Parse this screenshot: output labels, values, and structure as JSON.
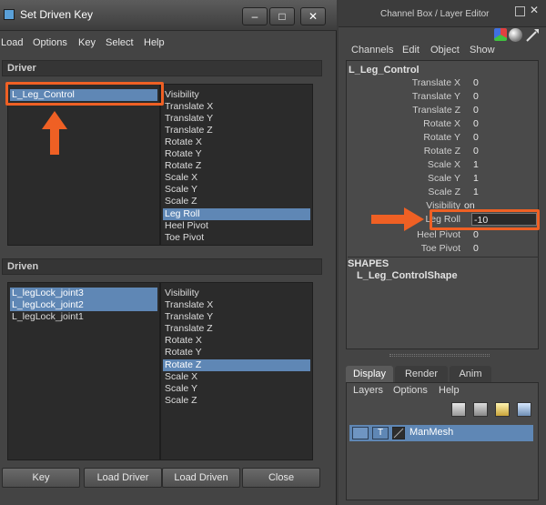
{
  "sdk": {
    "title": "Set Driven Key",
    "winbtns": [
      "–",
      "□",
      "✕"
    ],
    "menu": [
      "Load",
      "Options",
      "Key",
      "Select",
      "Help"
    ],
    "driver": {
      "header": "Driver",
      "objects": [
        "L_Leg_Control"
      ],
      "attributes": [
        "Visibility",
        "Translate X",
        "Translate Y",
        "Translate Z",
        "Rotate X",
        "Rotate Y",
        "Rotate Z",
        "Scale X",
        "Scale Y",
        "Scale Z",
        "Leg Roll",
        "Heel Pivot",
        "Toe Pivot"
      ],
      "selected_attribute": "Leg Roll"
    },
    "driven": {
      "header": "Driven",
      "objects": [
        "L_legLock_joint3",
        "L_legLock_joint2",
        "L_legLock_joint1"
      ],
      "attributes": [
        "Visibility",
        "Translate X",
        "Translate Y",
        "Translate Z",
        "Rotate X",
        "Rotate Y",
        "Rotate Z",
        "Scale X",
        "Scale Y",
        "Scale Z"
      ],
      "selected_attribute": "Rotate Z"
    },
    "buttons": [
      "Key",
      "Load Driver",
      "Load Driven",
      "Close"
    ]
  },
  "channel_box": {
    "title": "Channel Box / Layer Editor",
    "menu": [
      "Channels",
      "Edit",
      "Object",
      "Show"
    ],
    "object_name": "L_Leg_Control",
    "channels": [
      {
        "label": "Translate X",
        "value": "0"
      },
      {
        "label": "Translate Y",
        "value": "0"
      },
      {
        "label": "Translate Z",
        "value": "0"
      },
      {
        "label": "Rotate X",
        "value": "0"
      },
      {
        "label": "Rotate Y",
        "value": "0"
      },
      {
        "label": "Rotate Z",
        "value": "0"
      },
      {
        "label": "Scale X",
        "value": "1"
      },
      {
        "label": "Scale Y",
        "value": "1"
      },
      {
        "label": "Scale Z",
        "value": "1"
      },
      {
        "label": "Visibility",
        "value": "on"
      },
      {
        "label": "Leg Roll",
        "value": "-10"
      },
      {
        "label": "Heel Pivot",
        "value": "0"
      },
      {
        "label": "Toe Pivot",
        "value": "0"
      }
    ],
    "shapes_header": "SHAPES",
    "shape_name": "L_Leg_ControlShape",
    "tabs": [
      "Display",
      "Render",
      "Anim"
    ],
    "layer_menu": [
      "Layers",
      "Options",
      "Help"
    ],
    "layer": {
      "visibility": "",
      "type": "T",
      "name": "ManMesh"
    }
  },
  "colors": {
    "highlight": "#5f87b5",
    "annotation": "#ef6024"
  }
}
